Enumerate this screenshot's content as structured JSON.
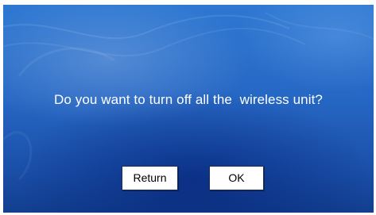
{
  "dialog": {
    "message": "Do you want to turn off all the  wireless unit?",
    "return_label": "Return",
    "ok_label": "OK"
  },
  "colors": {
    "background_top": "#2e78d2",
    "background_bottom": "#123e8e",
    "text": "#ffffff",
    "button_bg": "#ffffff"
  }
}
